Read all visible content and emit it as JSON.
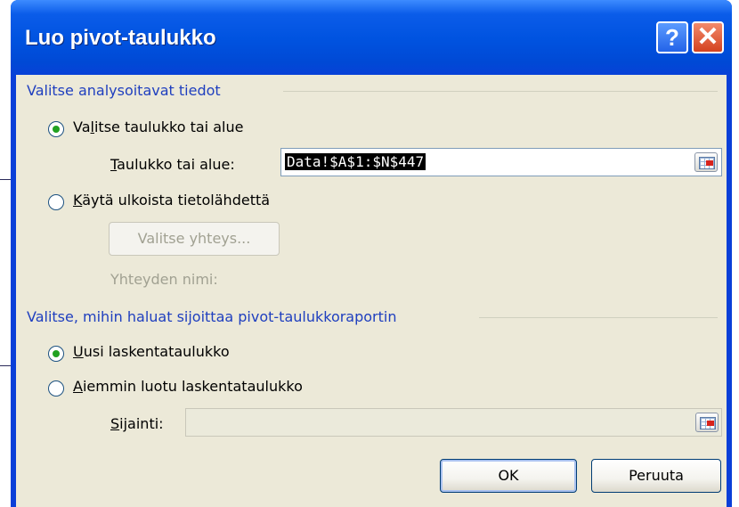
{
  "window": {
    "title": "Luo pivot-taulukko",
    "help_label": "?",
    "close_label": "✕"
  },
  "section1": {
    "label": "Valitse analysoitavat tiedot",
    "option_table": {
      "label": "Valitse taulukko tai alue",
      "checked": true
    },
    "table_field": {
      "label": "Taulukko tai alue:",
      "value": "Data!$A$1:$N$447"
    },
    "option_external": {
      "label": "Käytä ulkoista tietolähdettä",
      "checked": false
    },
    "choose_connection_button": "Valitse yhteys...",
    "connection_name_label": "Yhteyden nimi:"
  },
  "section2": {
    "label": "Valitse, mihin haluat sijoittaa pivot-taulukkoraportin",
    "option_new_sheet": {
      "label": "Uusi laskentataulukko",
      "checked": true
    },
    "option_existing_sheet": {
      "label": "Aiemmin luotu laskentataulukko",
      "checked": false
    },
    "location_field": {
      "label": "Sijainti:",
      "value": ""
    }
  },
  "buttons": {
    "ok": "OK",
    "cancel": "Peruuta"
  },
  "icons": {
    "range_selector": "range-select-icon",
    "help": "help-icon",
    "close": "close-icon"
  },
  "colors": {
    "titlebar": "#0053e0",
    "section_label": "#1f3fbf",
    "dialog_bg": "#ece9d8",
    "radio_dot": "#21a121"
  }
}
